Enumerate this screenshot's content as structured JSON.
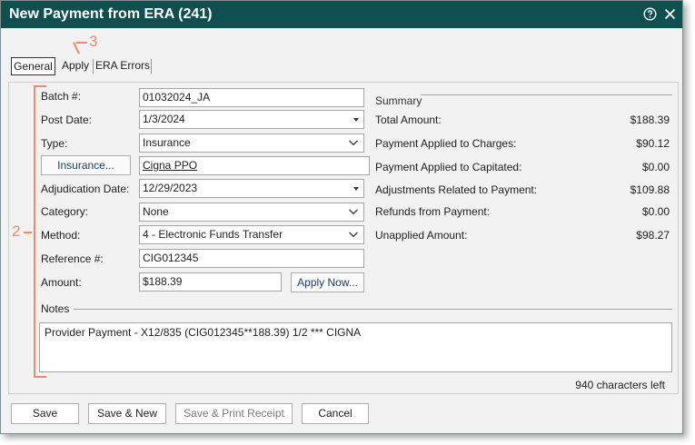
{
  "window": {
    "title": "New Payment from ERA (241)"
  },
  "tabs": [
    {
      "label": "General"
    },
    {
      "label": "Apply"
    },
    {
      "label": "ERA Errors"
    }
  ],
  "callouts": {
    "apply": "3",
    "general": "2"
  },
  "form": {
    "batch": {
      "label": "Batch #:",
      "value": "01032024_JA"
    },
    "post_date": {
      "label": "Post Date:",
      "value": "1/3/2024"
    },
    "type": {
      "label": "Type:",
      "value": "Insurance"
    },
    "insurance": {
      "button": "Insurance...",
      "value": "Cigna PPO"
    },
    "adjudication_date": {
      "label": "Adjudication Date:",
      "value": "12/29/2023"
    },
    "category": {
      "label": "Category:",
      "value": "None"
    },
    "method": {
      "label": "Method:",
      "value": "4 - Electronic Funds Transfer"
    },
    "reference": {
      "label": "Reference #:",
      "value": "CIG012345"
    },
    "amount": {
      "label": "Amount:",
      "value": "$188.39",
      "apply_now": "Apply Now..."
    }
  },
  "summary": {
    "title": "Summary",
    "rows": [
      {
        "label": "Total Amount:",
        "value": "$188.39"
      },
      {
        "label": "Payment Applied to Charges:",
        "value": "$90.12"
      },
      {
        "label": "Payment Applied to Capitated:",
        "value": "$0.00"
      },
      {
        "label": "Adjustments Related to Payment:",
        "value": "$109.88"
      },
      {
        "label": "Refunds from Payment:",
        "value": "$0.00"
      },
      {
        "label": "Unapplied Amount:",
        "value": "$98.27"
      }
    ]
  },
  "notes": {
    "label": "Notes",
    "value": "Provider Payment - X12/835 (CIG012345**188.39) 1/2 *** CIGNA",
    "chars_left": "940 characters left"
  },
  "buttons": {
    "save": "Save",
    "save_new": "Save & New",
    "save_print": "Save & Print Receipt",
    "cancel": "Cancel"
  },
  "colors": {
    "titlebar": "#0f4f4f",
    "callout": "#f08a6a"
  }
}
